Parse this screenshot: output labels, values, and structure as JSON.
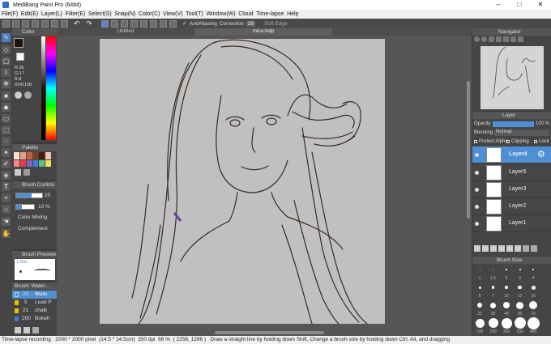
{
  "window": {
    "title": "MediBang Paint Pro (64bit)",
    "minimize": "–",
    "maximize": "□",
    "close": "✕"
  },
  "menu": [
    "File(F)",
    "Edit(E)",
    "Layer(L)",
    "Filter(E)",
    "Select(S)",
    "Snap(N)",
    "Color(C)",
    "View(V)",
    "Tool(T)",
    "Window(W)",
    "Cloud",
    "Time-lapse",
    "Help"
  ],
  "toolbar": {
    "antialiasing": "AntiAliasing",
    "correction": "Correction",
    "correction_value": "29",
    "soft_edge": "Soft Edge"
  },
  "tabs": {
    "untitled": "Untitled",
    "file": "mina.mdp"
  },
  "color_panel": {
    "title": "Color",
    "r": "R:36",
    "g": "G:17",
    "b": "B:8",
    "hex": "#241108",
    "fg": "#241108"
  },
  "palette": {
    "title": "Palette"
  },
  "brush_control": {
    "title": "Brush Control",
    "size": "20",
    "opacity": "10 %",
    "color_mixing": "Color Mixing",
    "complement": "Complement"
  },
  "brush_preview": {
    "title": "Brush Preview",
    "size_label": "1.46m"
  },
  "brush_list": {
    "title": "Brush: Water...",
    "items": [
      {
        "size": "20",
        "name": "Wate",
        "color": "#4f8fd3"
      },
      {
        "size": "5",
        "name": "Lead P",
        "color": "#e5c100"
      },
      {
        "size": "21",
        "name": "chalk",
        "color": "#e5c100"
      },
      {
        "size": "200",
        "name": "Bokeh",
        "color": "#3c78d8"
      }
    ]
  },
  "navigator": {
    "title": "Navigator"
  },
  "layer_panel": {
    "title": "Layer",
    "opacity_label": "Opacity",
    "opacity_value": "100 %",
    "blending_label": "Blending",
    "blending_value": "Normal",
    "protect_alpha": "Protect Alpha",
    "clipping": "Clipping",
    "lock": "Lock",
    "layers": [
      "Layer4",
      "Layer5",
      "Layer3",
      "Layer2",
      "Layer1"
    ]
  },
  "brush_size": {
    "title": "Brush Size",
    "sizes": [
      "1",
      "1.5",
      "2",
      "3",
      "4",
      "5",
      "7",
      "10",
      "12",
      "15",
      "20",
      "30",
      "40",
      "50",
      "70",
      "100",
      "150",
      "200",
      "300",
      "400"
    ]
  },
  "status": {
    "recording": "Time-lapse recording",
    "dimensions": "2000 * 2000 pixel",
    "cm": "(14.5 * 14.5cm)",
    "dpi": "350 dpi",
    "zoom": "66 %",
    "coords": "( 2258, 1286 )",
    "hint": "Draw a straight line by holding down Shift, Change a brush size by holding down Ctrl, Alt, and dragging"
  }
}
